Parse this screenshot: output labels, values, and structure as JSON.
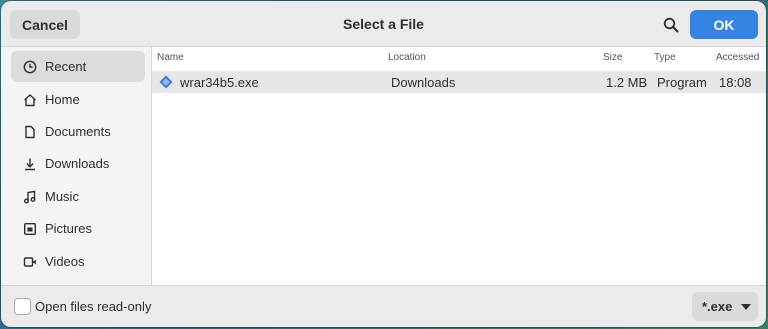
{
  "header": {
    "cancel_label": "Cancel",
    "title": "Select a File",
    "ok_label": "OK",
    "accent": "#3584e4"
  },
  "sidebar": {
    "items": [
      {
        "label": "Recent",
        "icon": "clock-icon",
        "active": true
      },
      {
        "label": "Home",
        "icon": "home-icon"
      },
      {
        "label": "Documents",
        "icon": "document-icon"
      },
      {
        "label": "Downloads",
        "icon": "download-icon"
      },
      {
        "label": "Music",
        "icon": "music-icon"
      },
      {
        "label": "Pictures",
        "icon": "picture-icon"
      },
      {
        "label": "Videos",
        "icon": "video-icon"
      }
    ]
  },
  "columns": {
    "name": "Name",
    "location": "Location",
    "size": "Size",
    "type": "Type",
    "accessed": "Accessed"
  },
  "files": [
    {
      "name": "wrar34b5.exe",
      "location": "Downloads",
      "size": "1.2 MB",
      "type": "Program",
      "accessed": "18:08",
      "icon": "executable-icon"
    }
  ],
  "footer": {
    "readonly_label": "Open files read-only",
    "readonly_checked": false,
    "filter_value": "*.exe"
  }
}
